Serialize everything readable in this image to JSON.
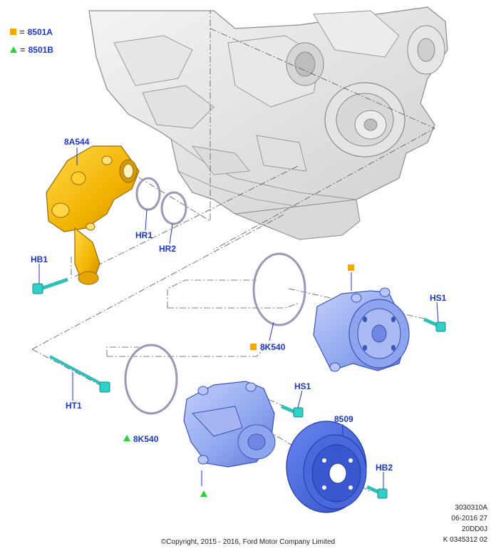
{
  "legend": [
    {
      "symbol": "square",
      "color": "#f6a800",
      "equals": "=",
      "code": "8501A"
    },
    {
      "symbol": "triangle",
      "color": "#2bd13a",
      "equals": "=",
      "code": "8501B"
    }
  ],
  "callouts": {
    "housing": "8A544",
    "hr1": "HR1",
    "hr2": "HR2",
    "hb1": "HB1",
    "ring_upper": "8K540",
    "hs1_upper": "HS1",
    "ht1": "HT1",
    "ring_lower": "8K540",
    "hs1_lower": "HS1",
    "pulley": "8509",
    "hb2": "HB2"
  },
  "reference": [
    "3030310A",
    "06-2016 27",
    "20DD0J",
    "K 0345312 02"
  ],
  "copyright": "©Copyright, 2015 - 2016, Ford Motor Company Limited",
  "colors": {
    "label": "#1b37c9",
    "housing": "#f2b800",
    "pump": "#8ea4ee",
    "fastener": "#2fd0c8",
    "seal": "#9b98b6"
  }
}
